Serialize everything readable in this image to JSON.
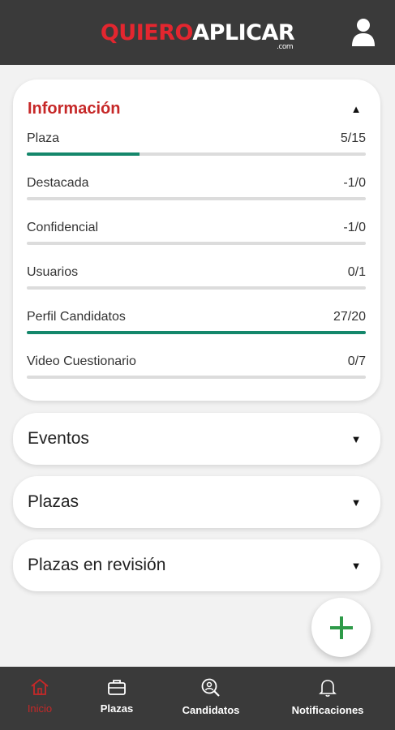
{
  "header": {
    "logo_part1": "QUIERO",
    "logo_part2": "APLICAR",
    "logo_suffix": ".com",
    "brand_red": "#e3262f",
    "bar_color": "#3a3a3a",
    "user_icon": "user-icon"
  },
  "info_card": {
    "title": "Información",
    "expanded_icon": "caret-up-icon",
    "accent_color": "#c62828",
    "progress_color": "#14876b",
    "metrics": [
      {
        "label": "Plaza",
        "value": "5/15",
        "progress": 0.333
      },
      {
        "label": "Destacada",
        "value": "-1/0",
        "progress": 0
      },
      {
        "label": "Confidencial",
        "value": "-1/0",
        "progress": 0
      },
      {
        "label": "Usuarios",
        "value": "0/1",
        "progress": 0
      },
      {
        "label": "Perfil Candidatos",
        "value": "27/20",
        "progress": 1
      },
      {
        "label": "Video Cuestionario",
        "value": "0/7",
        "progress": 0
      }
    ]
  },
  "sections": [
    {
      "title": "Eventos",
      "icon": "caret-down-icon"
    },
    {
      "title": "Plazas",
      "icon": "caret-down-icon"
    },
    {
      "title": "Plazas en revisión",
      "icon": "caret-down-icon"
    }
  ],
  "fab": {
    "icon": "plus-icon",
    "color": "#2e9a48"
  },
  "bottom_nav": {
    "items": [
      {
        "label": "Inicio",
        "icon": "home-icon",
        "active": true
      },
      {
        "label": "Plazas",
        "icon": "briefcase-icon",
        "active": false
      },
      {
        "label": "Candidatos",
        "icon": "search-person-icon",
        "active": false
      },
      {
        "label": "Notificaciones",
        "icon": "bell-icon",
        "active": false
      }
    ]
  }
}
